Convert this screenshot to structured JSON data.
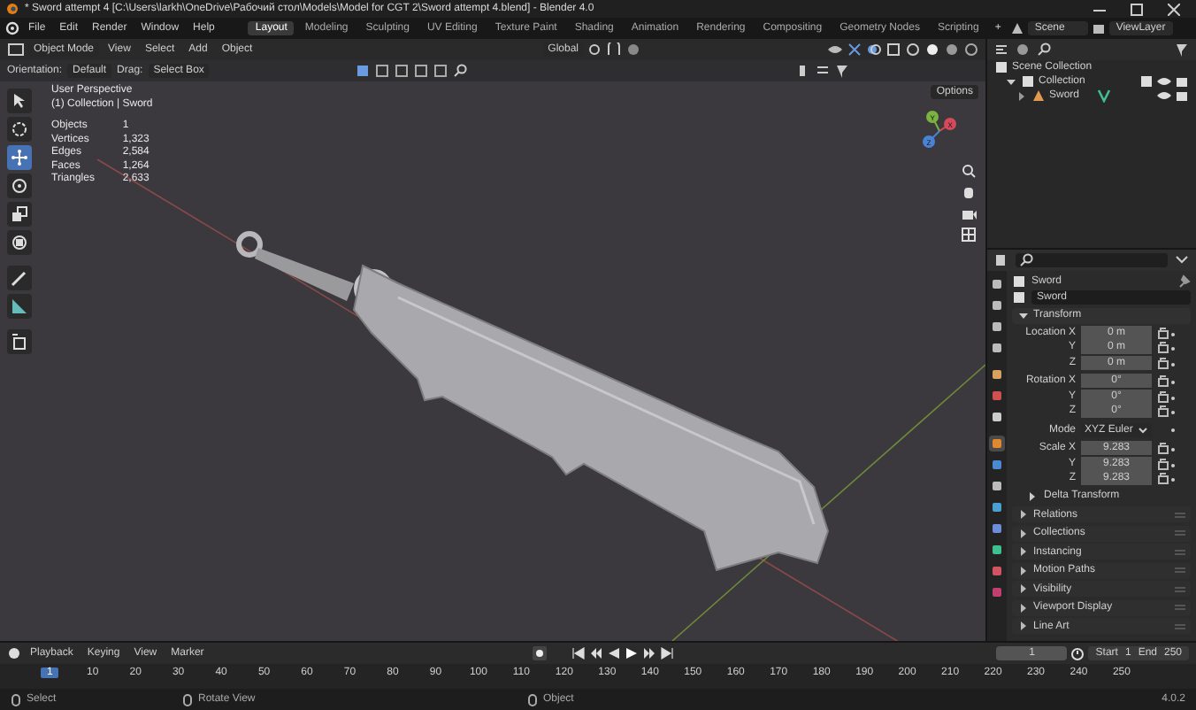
{
  "window": {
    "title": "* Sword attempt 4 [C:\\Users\\larkh\\OneDrive\\Рабочий стол\\Models\\Model for CGT 2\\Sword attempt 4.blend] - Blender 4.0"
  },
  "menu": [
    "File",
    "Edit",
    "Render",
    "Window",
    "Help"
  ],
  "workspaces": [
    {
      "label": "Layout",
      "selected": true
    },
    {
      "label": "Modeling",
      "selected": false
    },
    {
      "label": "Sculpting",
      "selected": false
    },
    {
      "label": "UV Editing",
      "selected": false
    },
    {
      "label": "Texture Paint",
      "selected": false
    },
    {
      "label": "Shading",
      "selected": false
    },
    {
      "label": "Animation",
      "selected": false
    },
    {
      "label": "Rendering",
      "selected": false
    },
    {
      "label": "Compositing",
      "selected": false
    },
    {
      "label": "Geometry Nodes",
      "selected": false
    },
    {
      "label": "Scripting",
      "selected": false
    }
  ],
  "add_workspace": "+",
  "scene": "Scene",
  "view_layer": "ViewLayer",
  "viewport": {
    "mode": "Object Mode",
    "menus": [
      "View",
      "Select",
      "Add",
      "Object"
    ],
    "transform_orientation": "Global",
    "tool_settings": {
      "orientation_label": "Orientation:",
      "orientation": "Default",
      "drag_label": "Drag:",
      "drag": "Select Box",
      "options": "Options"
    },
    "tools": [
      {
        "kind": "select",
        "selected": false
      },
      {
        "kind": "cursor",
        "selected": false
      },
      {
        "kind": "move",
        "selected": true
      },
      {
        "kind": "rotate",
        "selected": false
      },
      {
        "kind": "scale",
        "selected": false
      },
      {
        "kind": "transform",
        "selected": false
      },
      {
        "kind": "annotate",
        "selected": false
      },
      {
        "kind": "measure",
        "selected": false
      },
      {
        "kind": "add-cube",
        "selected": false
      }
    ],
    "view_name": "User Perspective",
    "context": "(1) Collection | Sword",
    "stats": [
      {
        "label": "Objects",
        "value": "1"
      },
      {
        "label": "Vertices",
        "value": "1,323"
      },
      {
        "label": "Edges",
        "value": "2,584"
      },
      {
        "label": "Faces",
        "value": "1,264"
      },
      {
        "label": "Triangles",
        "value": "2,633"
      }
    ],
    "gizmo_axes": [
      "X",
      "Y",
      "Z"
    ]
  },
  "outliner": {
    "tree": [
      {
        "label": "Scene Collection",
        "children": [
          {
            "label": "Collection",
            "expanded": true,
            "children": [
              {
                "label": "Sword"
              }
            ]
          }
        ]
      }
    ]
  },
  "properties": {
    "tabs": [
      {
        "kind": "tool",
        "selected": false
      },
      {
        "kind": "render",
        "selected": false
      },
      {
        "kind": "output",
        "selected": false
      },
      {
        "kind": "view-layer",
        "selected": false
      },
      {
        "kind": "scene",
        "selected": false
      },
      {
        "kind": "world",
        "selected": false
      },
      {
        "kind": "collection",
        "selected": false
      },
      {
        "kind": "object",
        "selected": true
      },
      {
        "kind": "modifiers",
        "selected": false
      },
      {
        "kind": "particles",
        "selected": false
      },
      {
        "kind": "physics",
        "selected": false
      },
      {
        "kind": "constraints",
        "selected": false
      },
      {
        "kind": "data",
        "selected": false
      },
      {
        "kind": "material",
        "selected": false
      },
      {
        "kind": "texture",
        "selected": false
      }
    ],
    "object": "Sword",
    "name": "Sword",
    "transform": {
      "title": "Transform",
      "expanded": true,
      "rows": [
        {
          "kind": "vector",
          "axes": [
            {
              "label": "Location X",
              "value": "0 m"
            },
            {
              "label": "Y",
              "value": "0 m"
            },
            {
              "label": "Z",
              "value": "0 m"
            }
          ]
        },
        {
          "kind": "vector",
          "axes": [
            {
              "label": "Rotation X",
              "value": "0°"
            },
            {
              "label": "Y",
              "value": "0°"
            },
            {
              "label": "Z",
              "value": "0°"
            }
          ]
        },
        {
          "kind": "dropdown",
          "label": "Mode",
          "value": "XYZ Euler"
        },
        {
          "kind": "vector",
          "axes": [
            {
              "label": "Scale X",
              "value": "9.283"
            },
            {
              "label": "Y",
              "value": "9.283"
            },
            {
              "label": "Z",
              "value": "9.283"
            }
          ]
        }
      ],
      "subpanel": {
        "title": "Delta Transform",
        "expanded": false
      }
    },
    "panels": [
      {
        "title": "Relations",
        "expanded": false
      },
      {
        "title": "Collections",
        "expanded": false
      },
      {
        "title": "Instancing",
        "expanded": false
      },
      {
        "title": "Motion Paths",
        "expanded": false
      },
      {
        "title": "Visibility",
        "expanded": false
      },
      {
        "title": "Viewport Display",
        "expanded": false
      },
      {
        "title": "Line Art",
        "expanded": false
      }
    ]
  },
  "timeline": {
    "menus": [
      "Playback",
      "Keying",
      "View",
      "Marker"
    ],
    "current_frame": "1",
    "start_label": "Start",
    "start": "1",
    "end_label": "End",
    "end": "250",
    "ticks": [
      {
        "label": "1",
        "selected": true
      },
      {
        "label": "10",
        "selected": false
      },
      {
        "label": "20",
        "selected": false
      },
      {
        "label": "30",
        "selected": false
      },
      {
        "label": "40",
        "selected": false
      },
      {
        "label": "50",
        "selected": false
      },
      {
        "label": "60",
        "selected": false
      },
      {
        "label": "70",
        "selected": false
      },
      {
        "label": "80",
        "selected": false
      },
      {
        "label": "90",
        "selected": false
      },
      {
        "label": "100",
        "selected": false
      },
      {
        "label": "110",
        "selected": false
      },
      {
        "label": "120",
        "selected": false
      },
      {
        "label": "130",
        "selected": false
      },
      {
        "label": "140",
        "selected": false
      },
      {
        "label": "150",
        "selected": false
      },
      {
        "label": "160",
        "selected": false
      },
      {
        "label": "170",
        "selected": false
      },
      {
        "label": "180",
        "selected": false
      },
      {
        "label": "190",
        "selected": false
      },
      {
        "label": "200",
        "selected": false
      },
      {
        "label": "210",
        "selected": false
      },
      {
        "label": "220",
        "selected": false
      },
      {
        "label": "230",
        "selected": false
      },
      {
        "label": "240",
        "selected": false
      },
      {
        "label": "250",
        "selected": false
      }
    ]
  },
  "status_bar": {
    "items": [
      "Select",
      "Rotate View",
      "Object"
    ],
    "version": "4.0.2"
  }
}
